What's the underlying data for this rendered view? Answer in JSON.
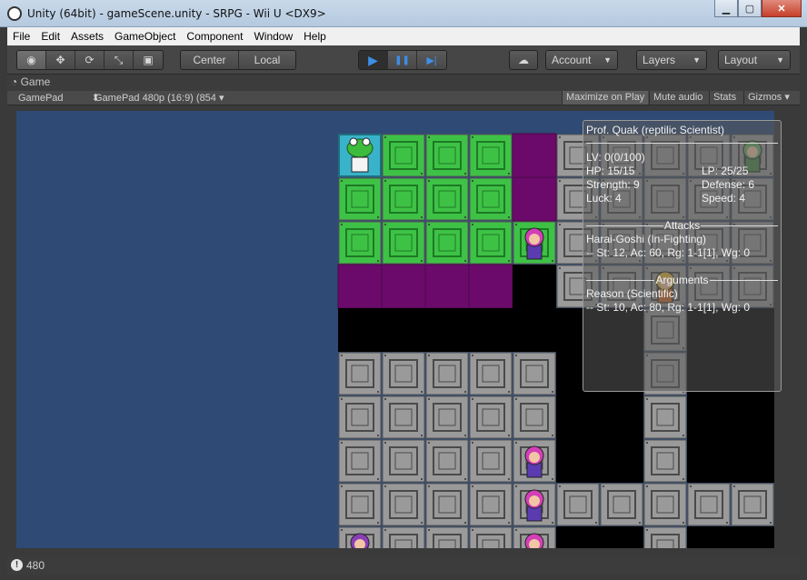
{
  "window": {
    "title": "Unity (64bit) - gameScene.unity - SRPG - Wii U <DX9>",
    "minimize_glyph": "▁",
    "maximize_glyph": "▢",
    "close_glyph": "✕"
  },
  "menu": [
    "File",
    "Edit",
    "Assets",
    "GameObject",
    "Component",
    "Window",
    "Help"
  ],
  "toolbar": {
    "tools": [
      {
        "icon": "eye-icon",
        "glyph": "◉"
      },
      {
        "icon": "move-icon",
        "glyph": "✥"
      },
      {
        "icon": "rotate-icon",
        "glyph": "⟳"
      },
      {
        "icon": "scale-icon",
        "glyph": "⤡"
      },
      {
        "icon": "rect-icon",
        "glyph": "▣"
      }
    ],
    "pivot_label": "Center",
    "space_label": "Local",
    "play_glyph": "▶",
    "pause_glyph": "❚❚",
    "step_glyph": "▶|",
    "cloud_glyph": "☁",
    "account_label": "Account",
    "layers_label": "Layers",
    "layout_label": "Layout"
  },
  "game_panel": {
    "tab_label": "Game",
    "display_label": "GamePad",
    "resolution_label": "GamePad 480p (16:9) (854",
    "maximize_label": "Maximize on Play",
    "mute_label": "Mute audio",
    "stats_label": "Stats",
    "gizmos_label": "Gizmos"
  },
  "unit_info": {
    "name": "Prof. Quak (reptilic Scientist)",
    "level": "LV: 0(0/100)",
    "hp": "HP: 15/15",
    "lp": "LP: 25/25",
    "strength": "Strength: 9",
    "defense": "Defense: 6",
    "luck": "Luck: 4",
    "speed": "Speed: 4",
    "attacks_header": "Attacks",
    "attack_name": "Harai-Goshi (In-Fighting)",
    "attack_stats": "-- St: 12, Ac: 60, Rg: 1-1[1], Wg: 0",
    "arguments_header": "Arguments",
    "argument_name": "Reason (Scientific)",
    "argument_stats": "-- St: 10, Ac: 80, Rg: 1-1[1], Wg: 0"
  },
  "colors": {
    "background": "#2f4a74",
    "move_range": "#3ec246",
    "attack_range": "#6b0a6b",
    "floor": "#9a9a9a",
    "void": "#000000"
  },
  "status": {
    "text": "480"
  }
}
